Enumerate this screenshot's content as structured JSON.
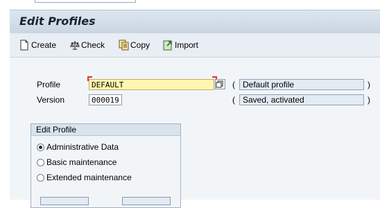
{
  "title": "Edit Profiles",
  "toolbar": {
    "create_label": "Create",
    "check_label": "Check",
    "copy_label": "Copy",
    "import_label": "Import"
  },
  "form": {
    "profile_label": "Profile",
    "profile_value": "DEFAULT",
    "profile_desc": "Default profile",
    "version_label": "Version",
    "version_value": "000019",
    "version_desc": "Saved, activated",
    "paren_open": "(",
    "paren_close": ")"
  },
  "edit_profile": {
    "title": "Edit Profile",
    "options": [
      {
        "label": "Administrative Data",
        "selected": true
      },
      {
        "label": "Basic maintenance",
        "selected": false
      },
      {
        "label": "Extended maintenance",
        "selected": false
      }
    ]
  }
}
